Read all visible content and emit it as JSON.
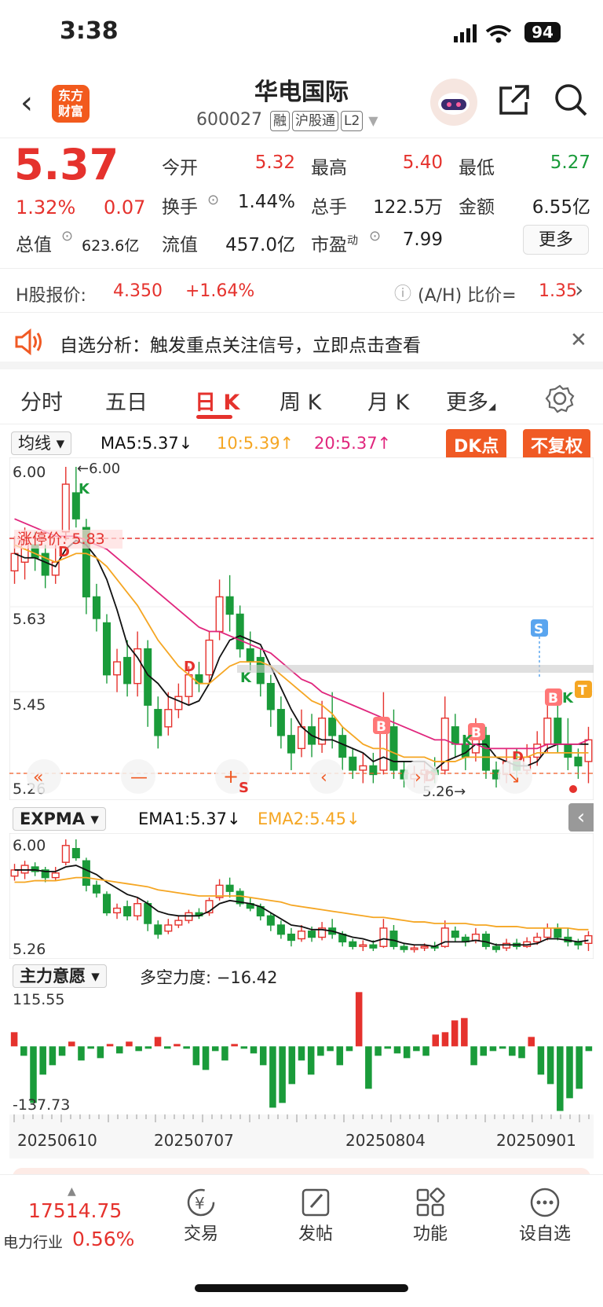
{
  "status": {
    "time": "3:38",
    "battery": "94"
  },
  "header": {
    "logo_line1": "东方",
    "logo_line2": "财富",
    "name": "华电国际",
    "code": "600027",
    "tags": [
      "融",
      "沪股通",
      "L2"
    ]
  },
  "quote": {
    "price": "5.37",
    "pct": "1.32%",
    "chg": "0.07",
    "open_lbl": "今开",
    "open": "5.32",
    "high_lbl": "最高",
    "high": "5.40",
    "low_lbl": "最低",
    "low": "5.27",
    "turn_lbl": "换手",
    "turn": "1.44%",
    "vol_lbl": "总手",
    "vol": "122.5万",
    "amt_lbl": "金额",
    "amt": "6.55亿",
    "mcap_lbl": "总值",
    "mcap": "623.6亿",
    "fcap_lbl": "流值",
    "fcap": "457.0亿",
    "pe_lbl": "市盈",
    "pe_sup": "动",
    "pe": "7.99",
    "more": "更多"
  },
  "hshare": {
    "label": "H股报价:",
    "price": "4.350",
    "pct": "+1.64%",
    "ratio_label": "(A/H) 比价=",
    "ratio": "1.35"
  },
  "notice": {
    "text": "自选分析：触发重点关注信号，立即点击查看"
  },
  "tabs": [
    {
      "label": "分时"
    },
    {
      "label": "五日"
    },
    {
      "label": "日 K"
    },
    {
      "label": "周 K"
    },
    {
      "label": "月 K"
    },
    {
      "label": "更多"
    }
  ],
  "kline": {
    "indicator": "均线",
    "ma5": "MA5:5.37↓",
    "ma10": "10:5.39↑",
    "ma20": "20:5.37↑",
    "dk": "DK点",
    "fq": "不复权",
    "y_top": "6.00",
    "y_mid1": "5.63",
    "y_mid2": "5.45",
    "y_bot": "5.26",
    "max_label": "←6.00",
    "min_label": "5.26→",
    "limit_label": "涨停价: 5.83",
    "colors": {
      "up": "#e5322d",
      "down": "#1a9b3a",
      "ma5": "#111111",
      "ma10": "#f5a623",
      "ma20": "#e0267d"
    }
  },
  "expma": {
    "indicator": "EXPMA",
    "ema1": "EMA1:5.37↓",
    "ema2": "EMA2:5.45↓",
    "y_top": "6.00",
    "y_bot": "5.26"
  },
  "zlyy": {
    "indicator": "主力意愿",
    "value": "多空力度: −16.42",
    "y_top": "115.55",
    "y_bot": "-137.73"
  },
  "dates": [
    "20250610",
    "20250707",
    "20250804",
    "20250901"
  ],
  "bottom": {
    "index_value": "17514.75",
    "index_name": "电力行业",
    "index_pct": "0.56%",
    "nav": [
      {
        "label": "交易"
      },
      {
        "label": "发帖"
      },
      {
        "label": "功能"
      },
      {
        "label": "设自选"
      }
    ]
  },
  "chart_data": {
    "type": "candlestick",
    "series": [
      {
        "values": [
          [
            5.76,
            5.8,
            5.84,
            5.73
          ],
          [
            5.78,
            5.83,
            5.86,
            5.74
          ],
          [
            5.82,
            5.79,
            5.85,
            5.76
          ],
          [
            5.8,
            5.75,
            5.82,
            5.72
          ],
          [
            5.75,
            5.78,
            5.82,
            5.73
          ],
          [
            5.85,
            5.96,
            6.0,
            5.83
          ],
          [
            5.94,
            5.88,
            6.0,
            5.86
          ],
          [
            5.86,
            5.7,
            5.88,
            5.66
          ],
          [
            5.7,
            5.65,
            5.73,
            5.62
          ],
          [
            5.64,
            5.52,
            5.66,
            5.5
          ],
          [
            5.52,
            5.55,
            5.58,
            5.48
          ],
          [
            5.56,
            5.5,
            5.6,
            5.47
          ],
          [
            5.5,
            5.58,
            5.62,
            5.47
          ],
          [
            5.58,
            5.45,
            5.6,
            5.4
          ],
          [
            5.44,
            5.38,
            5.47,
            5.35
          ],
          [
            5.4,
            5.44,
            5.48,
            5.38
          ],
          [
            5.44,
            5.47,
            5.5,
            5.42
          ],
          [
            5.47,
            5.52,
            5.54,
            5.45
          ],
          [
            5.52,
            5.5,
            5.55,
            5.48
          ],
          [
            5.52,
            5.6,
            5.62,
            5.5
          ],
          [
            5.62,
            5.7,
            5.74,
            5.6
          ],
          [
            5.7,
            5.66,
            5.75,
            5.62
          ],
          [
            5.66,
            5.58,
            5.68,
            5.56
          ],
          [
            5.58,
            5.55,
            5.62,
            5.53
          ],
          [
            5.56,
            5.5,
            5.58,
            5.47
          ],
          [
            5.5,
            5.44,
            5.52,
            5.4
          ],
          [
            5.44,
            5.38,
            5.47,
            5.35
          ],
          [
            5.38,
            5.34,
            5.42,
            5.3
          ],
          [
            5.35,
            5.4,
            5.44,
            5.33
          ],
          [
            5.4,
            5.36,
            5.43,
            5.33
          ],
          [
            5.36,
            5.42,
            5.46,
            5.34
          ],
          [
            5.42,
            5.38,
            5.48,
            5.35
          ],
          [
            5.38,
            5.33,
            5.4,
            5.3
          ],
          [
            5.33,
            5.3,
            5.35,
            5.28
          ],
          [
            5.3,
            5.31,
            5.34,
            5.27
          ],
          [
            5.31,
            5.29,
            5.34,
            5.27
          ],
          [
            5.3,
            5.42,
            5.48,
            5.29
          ],
          [
            5.4,
            5.3,
            5.44,
            5.28
          ],
          [
            5.3,
            5.28,
            5.32,
            5.26
          ],
          [
            5.28,
            5.29,
            5.31,
            5.26
          ],
          [
            5.29,
            5.3,
            5.32,
            5.27
          ],
          [
            5.3,
            5.29,
            5.33,
            5.27
          ],
          [
            5.3,
            5.42,
            5.47,
            5.29
          ],
          [
            5.4,
            5.36,
            5.43,
            5.33
          ],
          [
            5.36,
            5.33,
            5.38,
            5.3
          ],
          [
            5.34,
            5.38,
            5.42,
            5.32
          ],
          [
            5.38,
            5.3,
            5.4,
            5.28
          ],
          [
            5.3,
            5.28,
            5.32,
            5.26
          ],
          [
            5.29,
            5.32,
            5.35,
            5.27
          ],
          [
            5.32,
            5.3,
            5.35,
            5.28
          ],
          [
            5.3,
            5.33,
            5.36,
            5.29
          ],
          [
            5.33,
            5.36,
            5.39,
            5.31
          ],
          [
            5.36,
            5.42,
            5.45,
            5.34
          ],
          [
            5.42,
            5.36,
            5.45,
            5.34
          ],
          [
            5.36,
            5.33,
            5.42,
            5.3
          ],
          [
            5.33,
            5.31,
            5.35,
            5.28
          ],
          [
            5.32,
            5.37,
            5.4,
            5.27
          ]
        ]
      }
    ],
    "ma": [
      {
        "name": "MA5",
        "values": [
          5.8,
          5.79,
          5.79,
          5.78,
          5.77,
          5.81,
          5.83,
          5.82,
          5.79,
          5.74,
          5.67,
          5.59,
          5.56,
          5.52,
          5.5,
          5.47,
          5.46,
          5.45,
          5.46,
          5.5,
          5.56,
          5.6,
          5.61,
          5.6,
          5.59,
          5.54,
          5.49,
          5.44,
          5.4,
          5.38,
          5.37,
          5.37,
          5.36,
          5.35,
          5.34,
          5.32,
          5.33,
          5.32,
          5.32,
          5.32,
          5.32,
          5.3,
          5.32,
          5.33,
          5.34,
          5.36,
          5.36,
          5.33,
          5.32,
          5.31,
          5.31,
          5.32,
          5.35,
          5.36,
          5.36,
          5.36,
          5.36
        ]
      },
      {
        "name": "MA10",
        "values": [
          5.82,
          5.81,
          5.8,
          5.79,
          5.78,
          5.79,
          5.8,
          5.8,
          5.79,
          5.77,
          5.74,
          5.71,
          5.68,
          5.64,
          5.6,
          5.57,
          5.54,
          5.52,
          5.5,
          5.5,
          5.52,
          5.54,
          5.55,
          5.55,
          5.55,
          5.54,
          5.52,
          5.5,
          5.48,
          5.46,
          5.45,
          5.43,
          5.4,
          5.38,
          5.36,
          5.35,
          5.35,
          5.34,
          5.33,
          5.33,
          5.33,
          5.32,
          5.32,
          5.32,
          5.33,
          5.33,
          5.33,
          5.33,
          5.33,
          5.33,
          5.33,
          5.34,
          5.34,
          5.34,
          5.34,
          5.34,
          5.34
        ]
      },
      {
        "name": "MA20",
        "values": [
          5.88,
          5.87,
          5.86,
          5.85,
          5.84,
          5.84,
          5.84,
          5.83,
          5.82,
          5.81,
          5.79,
          5.77,
          5.75,
          5.73,
          5.71,
          5.69,
          5.67,
          5.65,
          5.63,
          5.62,
          5.62,
          5.61,
          5.6,
          5.59,
          5.58,
          5.57,
          5.55,
          5.53,
          5.51,
          5.5,
          5.48,
          5.47,
          5.46,
          5.45,
          5.44,
          5.43,
          5.42,
          5.41,
          5.4,
          5.39,
          5.38,
          5.37,
          5.37,
          5.36,
          5.36,
          5.36,
          5.35,
          5.35,
          5.35,
          5.35,
          5.35,
          5.35,
          5.36,
          5.36,
          5.36,
          5.36,
          5.37
        ]
      }
    ],
    "ema": [
      {
        "name": "EMA1",
        "values": [
          5.8,
          5.8,
          5.8,
          5.79,
          5.79,
          5.82,
          5.83,
          5.8,
          5.77,
          5.72,
          5.68,
          5.64,
          5.62,
          5.58,
          5.53,
          5.51,
          5.5,
          5.5,
          5.5,
          5.53,
          5.58,
          5.6,
          5.59,
          5.58,
          5.56,
          5.52,
          5.48,
          5.44,
          5.43,
          5.41,
          5.41,
          5.4,
          5.38,
          5.36,
          5.35,
          5.33,
          5.35,
          5.34,
          5.32,
          5.31,
          5.31,
          5.3,
          5.33,
          5.33,
          5.33,
          5.34,
          5.33,
          5.31,
          5.31,
          5.31,
          5.31,
          5.32,
          5.35,
          5.35,
          5.34,
          5.33,
          5.34
        ]
      },
      {
        "name": "EMA2",
        "values": [
          5.72,
          5.72,
          5.73,
          5.73,
          5.73,
          5.74,
          5.75,
          5.75,
          5.74,
          5.73,
          5.72,
          5.71,
          5.7,
          5.69,
          5.67,
          5.66,
          5.65,
          5.64,
          5.63,
          5.63,
          5.63,
          5.63,
          5.63,
          5.62,
          5.61,
          5.6,
          5.59,
          5.57,
          5.56,
          5.55,
          5.54,
          5.53,
          5.52,
          5.51,
          5.5,
          5.49,
          5.49,
          5.48,
          5.47,
          5.46,
          5.46,
          5.45,
          5.45,
          5.45,
          5.45,
          5.44,
          5.44,
          5.43,
          5.43,
          5.43,
          5.42,
          5.42,
          5.42,
          5.42,
          5.42,
          5.41,
          5.41
        ]
      }
    ],
    "zlyy": [
      30,
      -20,
      -120,
      -60,
      -40,
      -20,
      10,
      -30,
      -5,
      -25,
      5,
      -15,
      10,
      -10,
      -5,
      20,
      -5,
      5,
      -5,
      -40,
      -50,
      -10,
      -30,
      5,
      -5,
      -15,
      -40,
      -130,
      -120,
      -80,
      -30,
      -60,
      -20,
      -10,
      -40,
      -10,
      115,
      -90,
      -20,
      -5,
      -15,
      -25,
      -10,
      -20,
      25,
      30,
      55,
      60,
      -40,
      -20,
      -10,
      -5,
      -20,
      -25,
      20,
      -60,
      -80,
      -137,
      -110,
      -90,
      -10
    ]
  }
}
